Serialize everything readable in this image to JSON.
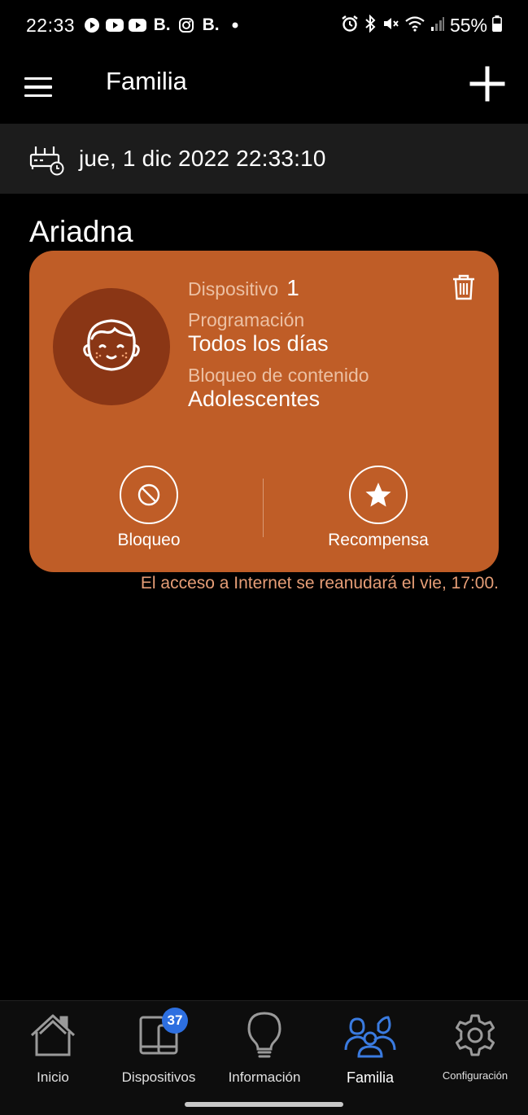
{
  "status_bar": {
    "time": "22:33",
    "left_icons": [
      "play-icon",
      "youtube-icon",
      "youtube-icon",
      "b-icon",
      "instagram-icon",
      "b-icon",
      "dot-icon"
    ],
    "left_text_b1": "B.",
    "left_text_b2": "B.",
    "right_icons": [
      "alarm-icon",
      "bluetooth-icon",
      "mute-icon",
      "wifi-icon",
      "signal-icon",
      "battery-icon"
    ],
    "battery_percent": "55%"
  },
  "app_bar": {
    "title": "Familia",
    "menu_icon": "hamburger-menu-icon",
    "add_icon": "plus-icon"
  },
  "date_bar": {
    "icon": "router-clock-icon",
    "datetime": "jue, 1 dic 2022 22:33:10"
  },
  "profile": {
    "name": "Ariadna",
    "card_color": "#bf5d27",
    "avatar_icon": "child-face-icon",
    "device_label": "Dispositivo",
    "device_count": "1",
    "schedule_label": "Programación",
    "schedule_value": "Todos los días",
    "content_block_label": "Bloqueo de contenido",
    "content_block_value": "Adolescentes",
    "delete_icon": "trash-icon",
    "actions": {
      "block_label": "Bloqueo",
      "block_icon": "block-icon",
      "reward_label": "Recompensa",
      "reward_icon": "star-icon"
    },
    "resume_notice": "El acceso a Internet se reanudará el vie, 17:00."
  },
  "bottom_nav": {
    "items": [
      {
        "label": "Inicio",
        "icon": "home-icon"
      },
      {
        "label": "Dispositivos",
        "icon": "devices-icon",
        "badge": "37"
      },
      {
        "label": "Información",
        "icon": "lightbulb-icon"
      },
      {
        "label": "Familia",
        "icon": "family-icon",
        "active": true
      },
      {
        "label": "Configuración",
        "icon": "gear-icon"
      }
    ],
    "active_color": "#3a7be0",
    "badge_color": "#2d6fe0"
  }
}
